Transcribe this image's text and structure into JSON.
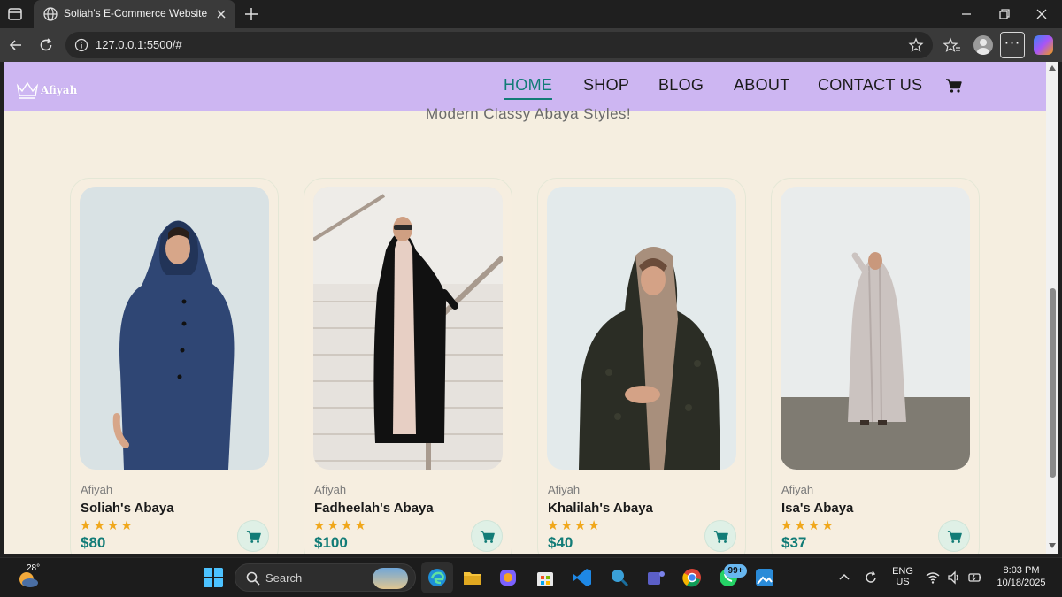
{
  "browser": {
    "tab_title": "Soliah's E-Commerce Website",
    "url": "127.0.0.1:5500/#"
  },
  "site": {
    "logo_text": "Afiyah",
    "nav": [
      "HOME",
      "SHOP",
      "BLOG",
      "ABOUT",
      "CONTACT US"
    ],
    "active_nav": "HOME",
    "subtitle": "Modern Classy Abaya Styles!",
    "products": [
      {
        "brand": "Afiyah",
        "name": "Soliah's Abaya",
        "rating": 4,
        "stars": "★★★★",
        "price": "$80"
      },
      {
        "brand": "Afiyah",
        "name": "Fadheelah's Abaya",
        "rating": 4,
        "stars": "★★★★",
        "price": "$100"
      },
      {
        "brand": "Afiyah",
        "name": "Khalilah's Abaya",
        "rating": 4,
        "stars": "★★★★",
        "price": "$40"
      },
      {
        "brand": "Afiyah",
        "name": "Isa's Abaya",
        "rating": 4,
        "stars": "★★★★",
        "price": "$37"
      }
    ]
  },
  "colors": {
    "header_bg": "#cdb6f2",
    "page_bg": "#f5eee0",
    "accent_teal": "#127c77",
    "star": "#f0a71b"
  },
  "taskbar": {
    "temperature": "28°",
    "search_placeholder": "Search",
    "notification_badge": "99+",
    "language": "ENG",
    "region": "US",
    "time": "8:03 PM",
    "date": "10/18/2025"
  }
}
